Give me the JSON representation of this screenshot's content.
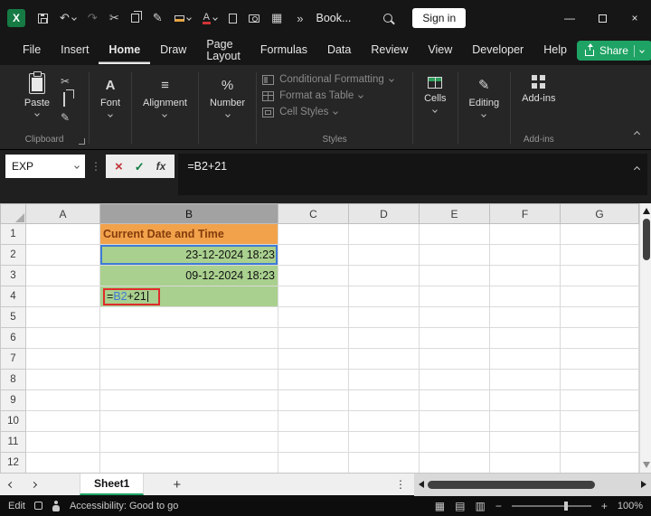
{
  "titlebar": {
    "workbook_name": "Book...",
    "sign_in": "Sign in",
    "more_commands": "»"
  },
  "menu": {
    "items": [
      "File",
      "Insert",
      "Home",
      "Draw",
      "Page Layout",
      "Formulas",
      "Data",
      "Review",
      "View",
      "Developer",
      "Help"
    ],
    "active": "Home",
    "share": "Share"
  },
  "ribbon": {
    "paste": "Paste",
    "font": "Font",
    "alignment": "Alignment",
    "number": "Number",
    "styles_items": [
      "Conditional Formatting",
      "Format as Table",
      "Cell Styles"
    ],
    "cells": "Cells",
    "editing": "Editing",
    "addins_button": "Add-ins",
    "labels": {
      "clipboard": "Clipboard",
      "styles": "Styles",
      "addins": "Add-ins"
    }
  },
  "formula_bar": {
    "name_box": "EXP",
    "fx": "fx",
    "formula": "=B2+21"
  },
  "grid": {
    "columns": [
      "A",
      "B",
      "C",
      "D",
      "E",
      "F",
      "G"
    ],
    "rows": [
      "1",
      "2",
      "3",
      "4",
      "5",
      "6",
      "7",
      "8",
      "9",
      "10",
      "11",
      "12"
    ],
    "selected_column": "B",
    "cells": {
      "B1": "Current Date and Time",
      "B2": "23-12-2024 18:23",
      "B3": "09-12-2024 18:23",
      "B4_eq": "=",
      "B4_ref": "B2",
      "B4_rest": "+21"
    }
  },
  "sheet_bar": {
    "tab": "Sheet1"
  },
  "status_bar": {
    "mode": "Edit",
    "accessibility": "Accessibility: Good to go",
    "zoom": "100%"
  },
  "colors": {
    "accent_green": "#1EA364",
    "orange_cell": "#F2A24B",
    "orange_text": "#843C0C",
    "green_cell": "#A9D08E",
    "ref_blue": "#3E7BD6",
    "annotation_red": "#E02B2B"
  },
  "icons": {
    "undo": "↶",
    "redo": "↷",
    "cut": "✂",
    "format_painter": "✎",
    "editing": "✎",
    "align": "≡",
    "percent": "%",
    "font_a": "A",
    "grid_view": "▦",
    "page_layout_view": "▤",
    "page_break_view": "▥",
    "dots": "⋮",
    "add": "+",
    "minus": "−",
    "plus": "+",
    "cancel": "×",
    "check": "✓",
    "minimize": "—",
    "close": "×"
  }
}
